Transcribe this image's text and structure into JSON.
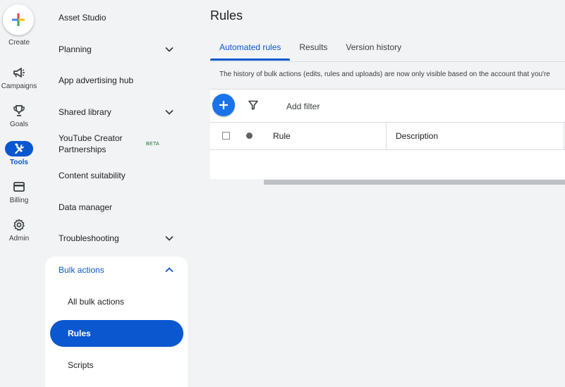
{
  "rail": {
    "create_label": "Create",
    "items": [
      {
        "label": "Campaigns",
        "icon": "megaphone-icon"
      },
      {
        "label": "Goals",
        "icon": "trophy-icon"
      },
      {
        "label": "Tools",
        "icon": "tools-icon",
        "active": true
      },
      {
        "label": "Billing",
        "icon": "credit-card-icon"
      },
      {
        "label": "Admin",
        "icon": "gear-icon"
      }
    ]
  },
  "nav": {
    "items": [
      {
        "label": "Asset Studio"
      },
      {
        "label": "Planning",
        "expandable": true
      },
      {
        "label": "App advertising hub"
      },
      {
        "label": "Shared library",
        "expandable": true
      },
      {
        "label": "YouTube Creator Partnerships",
        "badge": "BETA"
      },
      {
        "label": "Content suitability"
      },
      {
        "label": "Data manager"
      },
      {
        "label": "Troubleshooting",
        "expandable": true
      }
    ],
    "group": {
      "label": "Bulk actions",
      "items": [
        {
          "label": "All bulk actions"
        },
        {
          "label": "Rules",
          "selected": true
        },
        {
          "label": "Scripts"
        }
      ]
    }
  },
  "main": {
    "title": "Rules",
    "tabs": [
      {
        "label": "Automated rules",
        "active": true
      },
      {
        "label": "Results"
      },
      {
        "label": "Version history"
      }
    ],
    "notice": "The history of bulk actions (edits, rules and uploads) are now only visible based on the account that you're",
    "toolbar": {
      "add_filter": "Add filter"
    },
    "table": {
      "columns": [
        "Rule",
        "Description"
      ]
    }
  },
  "colors": {
    "accent": "#0b57d0",
    "background": "#f1f3f4"
  }
}
